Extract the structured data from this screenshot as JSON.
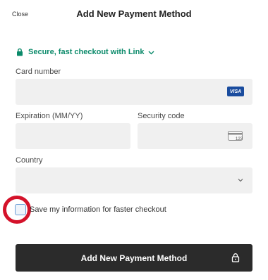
{
  "header": {
    "close_label": "Close",
    "title": "Add New Payment Method"
  },
  "link": {
    "text": "Secure, fast checkout with Link",
    "color": "#0b8a6a",
    "icons": [
      "lock-icon",
      "chevron-down-icon"
    ]
  },
  "card": {
    "label": "Card number",
    "value": "",
    "brand": "VISA"
  },
  "expiry": {
    "label": "Expiration (MM/YY)",
    "value": ""
  },
  "security": {
    "label": "Security code",
    "value": "",
    "icon_text": "123"
  },
  "country": {
    "label": "Country",
    "value": ""
  },
  "save": {
    "label": "Save my information for faster checkout",
    "checked": false
  },
  "submit": {
    "label": "Add New Payment Method",
    "color": "#2b2b2b"
  },
  "highlight_color": "#d4122a"
}
